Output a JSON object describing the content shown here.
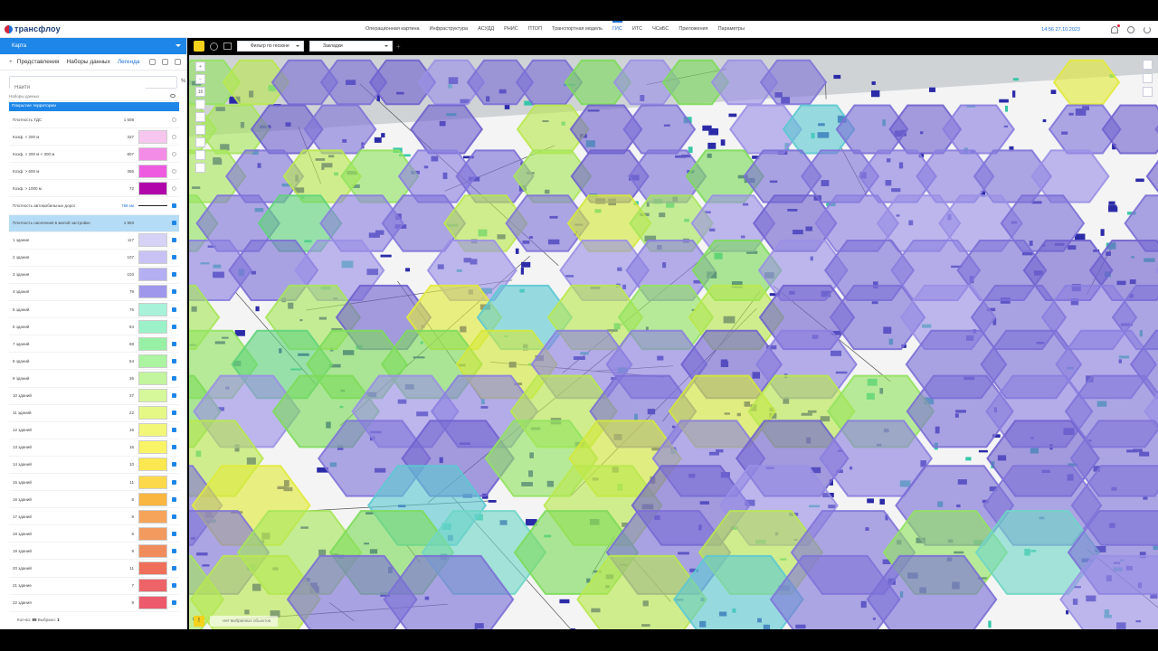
{
  "app": {
    "logo_text": "трансфлоу",
    "datetime": "14:56  27.10.2023"
  },
  "nav": [
    {
      "label": "Операционная картина",
      "active": false
    },
    {
      "label": "Инфраструктура",
      "active": false
    },
    {
      "label": "АСУДД",
      "active": false
    },
    {
      "label": "РНИС",
      "active": false
    },
    {
      "label": "ПТОП",
      "active": false
    },
    {
      "label": "Транспортная модель",
      "active": false
    },
    {
      "label": "ГИС",
      "active": true
    },
    {
      "label": "ИТС",
      "active": false
    },
    {
      "label": "ЧСиБС",
      "active": false
    },
    {
      "label": "Приложения",
      "active": false
    },
    {
      "label": "Параметры",
      "active": false
    }
  ],
  "panel": {
    "title": "Карта",
    "tabs": {
      "views": "Представления",
      "datasets": "Наборы данных",
      "legend": "Легенда"
    },
    "search_placeholder": "Найти",
    "sources_label": "Наборы данных",
    "layer_title": "Покрытие территории",
    "footer_label": "Кол-во:",
    "footer_count": "89",
    "footer_sel_label": "Выбрано:",
    "footer_sel": "1"
  },
  "legend": [
    {
      "label": "Плотность ТДС",
      "count": "1 508",
      "color": null,
      "checked": false
    },
    {
      "label": "Коэф. < 200 м",
      "count": "337",
      "color": "#f7c6ef",
      "checked": false
    },
    {
      "label": "Коэф. > 200 м < 300 м",
      "count": "807",
      "color": "#f38ce6",
      "checked": false
    },
    {
      "label": "Коэф. > 600 м",
      "count": "365",
      "color": "#ee5be0",
      "checked": false
    },
    {
      "label": "Коэф. > 1000 м",
      "count": "72",
      "color": "#b006aa",
      "checked": false
    },
    {
      "label": "Плотность автомобильных дорог",
      "count": "758 км",
      "color": "line",
      "checked": true
    },
    {
      "label": "Плотность населения в жилой застройке",
      "count": "1 993",
      "color": null,
      "checked": true,
      "selected": true
    },
    {
      "label": "1 здание",
      "count": "117",
      "color": "#d6d2f6",
      "checked": true
    },
    {
      "label": "2 здания",
      "count": "107",
      "color": "#c8c2f4",
      "checked": true
    },
    {
      "label": "3 здания",
      "count": "103",
      "color": "#b4aef2",
      "checked": true
    },
    {
      "label": "4 здания",
      "count": "79",
      "color": "#9f97ec",
      "checked": true
    },
    {
      "label": "5 зданий",
      "count": "76",
      "color": "#a8f2da",
      "checked": true
    },
    {
      "label": "6 зданий",
      "count": "84",
      "color": "#9cf2c8",
      "checked": true
    },
    {
      "label": "7 зданий",
      "count": "68",
      "color": "#98f0a5",
      "checked": true
    },
    {
      "label": "8 зданий",
      "count": "54",
      "color": "#abf4a0",
      "checked": true
    },
    {
      "label": "9 зданий",
      "count": "36",
      "color": "#c2f59d",
      "checked": true
    },
    {
      "label": "10 зданий",
      "count": "37",
      "color": "#d6f79a",
      "checked": true
    },
    {
      "label": "11 зданий",
      "count": "22",
      "color": "#e5f885",
      "checked": true
    },
    {
      "label": "12 зданий",
      "count": "15",
      "color": "#f2f778",
      "checked": true
    },
    {
      "label": "13 зданий",
      "count": "16",
      "color": "#f9f466",
      "checked": true
    },
    {
      "label": "14 зданий",
      "count": "10",
      "color": "#fbe74f",
      "checked": true
    },
    {
      "label": "15 зданий",
      "count": "11",
      "color": "#fcd94a",
      "checked": true
    },
    {
      "label": "16 зданий",
      "count": "8",
      "color": "#f9b640",
      "checked": true
    },
    {
      "label": "17 зданий",
      "count": "8",
      "color": "#f5a45a",
      "checked": true
    },
    {
      "label": "18 зданий",
      "count": "6",
      "color": "#f39a5f",
      "checked": true
    },
    {
      "label": "19 зданий",
      "count": "9",
      "color": "#f08b5c",
      "checked": true
    },
    {
      "label": "20 зданий",
      "count": "11",
      "color": "#ef6f5a",
      "checked": true
    },
    {
      "label": "21 здание",
      "count": "7",
      "color": "#ed6367",
      "checked": true
    },
    {
      "label": "22 здания",
      "count": "9",
      "color": "#ec5a6b",
      "checked": true
    }
  ],
  "map_toolbar": {
    "geo_filter": "Фильтр по геозоне",
    "bookmarks": "Закладки"
  },
  "bottom": {
    "selected_text": "Нет выбранных объектов"
  },
  "colors": {
    "accent": "#1d86e8",
    "active_nav": "#1d6fd6"
  }
}
